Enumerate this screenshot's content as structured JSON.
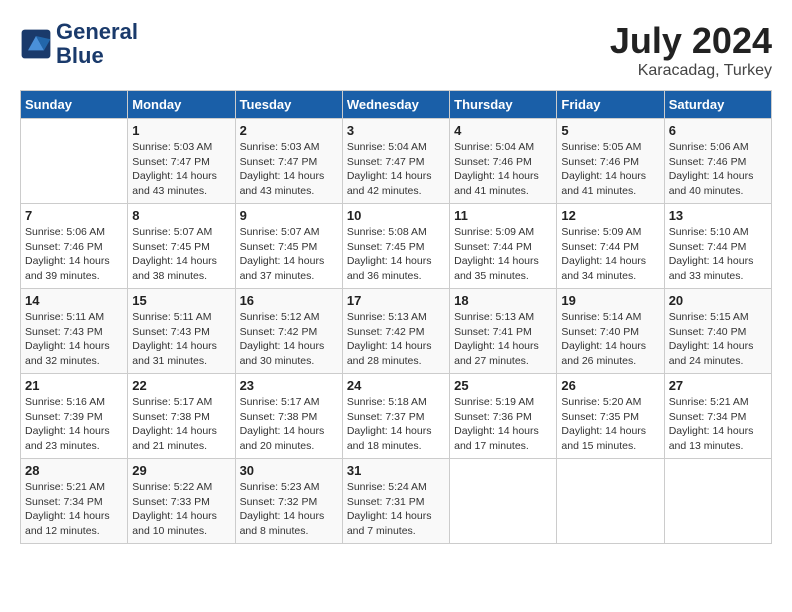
{
  "header": {
    "logo_line1": "General",
    "logo_line2": "Blue",
    "month_year": "July 2024",
    "location": "Karacadag, Turkey"
  },
  "columns": [
    "Sunday",
    "Monday",
    "Tuesday",
    "Wednesday",
    "Thursday",
    "Friday",
    "Saturday"
  ],
  "weeks": [
    [
      {
        "day": "",
        "sunrise": "",
        "sunset": "",
        "daylight": ""
      },
      {
        "day": "1",
        "sunrise": "Sunrise: 5:03 AM",
        "sunset": "Sunset: 7:47 PM",
        "daylight": "Daylight: 14 hours and 43 minutes."
      },
      {
        "day": "2",
        "sunrise": "Sunrise: 5:03 AM",
        "sunset": "Sunset: 7:47 PM",
        "daylight": "Daylight: 14 hours and 43 minutes."
      },
      {
        "day": "3",
        "sunrise": "Sunrise: 5:04 AM",
        "sunset": "Sunset: 7:47 PM",
        "daylight": "Daylight: 14 hours and 42 minutes."
      },
      {
        "day": "4",
        "sunrise": "Sunrise: 5:04 AM",
        "sunset": "Sunset: 7:46 PM",
        "daylight": "Daylight: 14 hours and 41 minutes."
      },
      {
        "day": "5",
        "sunrise": "Sunrise: 5:05 AM",
        "sunset": "Sunset: 7:46 PM",
        "daylight": "Daylight: 14 hours and 41 minutes."
      },
      {
        "day": "6",
        "sunrise": "Sunrise: 5:06 AM",
        "sunset": "Sunset: 7:46 PM",
        "daylight": "Daylight: 14 hours and 40 minutes."
      }
    ],
    [
      {
        "day": "7",
        "sunrise": "Sunrise: 5:06 AM",
        "sunset": "Sunset: 7:46 PM",
        "daylight": "Daylight: 14 hours and 39 minutes."
      },
      {
        "day": "8",
        "sunrise": "Sunrise: 5:07 AM",
        "sunset": "Sunset: 7:45 PM",
        "daylight": "Daylight: 14 hours and 38 minutes."
      },
      {
        "day": "9",
        "sunrise": "Sunrise: 5:07 AM",
        "sunset": "Sunset: 7:45 PM",
        "daylight": "Daylight: 14 hours and 37 minutes."
      },
      {
        "day": "10",
        "sunrise": "Sunrise: 5:08 AM",
        "sunset": "Sunset: 7:45 PM",
        "daylight": "Daylight: 14 hours and 36 minutes."
      },
      {
        "day": "11",
        "sunrise": "Sunrise: 5:09 AM",
        "sunset": "Sunset: 7:44 PM",
        "daylight": "Daylight: 14 hours and 35 minutes."
      },
      {
        "day": "12",
        "sunrise": "Sunrise: 5:09 AM",
        "sunset": "Sunset: 7:44 PM",
        "daylight": "Daylight: 14 hours and 34 minutes."
      },
      {
        "day": "13",
        "sunrise": "Sunrise: 5:10 AM",
        "sunset": "Sunset: 7:44 PM",
        "daylight": "Daylight: 14 hours and 33 minutes."
      }
    ],
    [
      {
        "day": "14",
        "sunrise": "Sunrise: 5:11 AM",
        "sunset": "Sunset: 7:43 PM",
        "daylight": "Daylight: 14 hours and 32 minutes."
      },
      {
        "day": "15",
        "sunrise": "Sunrise: 5:11 AM",
        "sunset": "Sunset: 7:43 PM",
        "daylight": "Daylight: 14 hours and 31 minutes."
      },
      {
        "day": "16",
        "sunrise": "Sunrise: 5:12 AM",
        "sunset": "Sunset: 7:42 PM",
        "daylight": "Daylight: 14 hours and 30 minutes."
      },
      {
        "day": "17",
        "sunrise": "Sunrise: 5:13 AM",
        "sunset": "Sunset: 7:42 PM",
        "daylight": "Daylight: 14 hours and 28 minutes."
      },
      {
        "day": "18",
        "sunrise": "Sunrise: 5:13 AM",
        "sunset": "Sunset: 7:41 PM",
        "daylight": "Daylight: 14 hours and 27 minutes."
      },
      {
        "day": "19",
        "sunrise": "Sunrise: 5:14 AM",
        "sunset": "Sunset: 7:40 PM",
        "daylight": "Daylight: 14 hours and 26 minutes."
      },
      {
        "day": "20",
        "sunrise": "Sunrise: 5:15 AM",
        "sunset": "Sunset: 7:40 PM",
        "daylight": "Daylight: 14 hours and 24 minutes."
      }
    ],
    [
      {
        "day": "21",
        "sunrise": "Sunrise: 5:16 AM",
        "sunset": "Sunset: 7:39 PM",
        "daylight": "Daylight: 14 hours and 23 minutes."
      },
      {
        "day": "22",
        "sunrise": "Sunrise: 5:17 AM",
        "sunset": "Sunset: 7:38 PM",
        "daylight": "Daylight: 14 hours and 21 minutes."
      },
      {
        "day": "23",
        "sunrise": "Sunrise: 5:17 AM",
        "sunset": "Sunset: 7:38 PM",
        "daylight": "Daylight: 14 hours and 20 minutes."
      },
      {
        "day": "24",
        "sunrise": "Sunrise: 5:18 AM",
        "sunset": "Sunset: 7:37 PM",
        "daylight": "Daylight: 14 hours and 18 minutes."
      },
      {
        "day": "25",
        "sunrise": "Sunrise: 5:19 AM",
        "sunset": "Sunset: 7:36 PM",
        "daylight": "Daylight: 14 hours and 17 minutes."
      },
      {
        "day": "26",
        "sunrise": "Sunrise: 5:20 AM",
        "sunset": "Sunset: 7:35 PM",
        "daylight": "Daylight: 14 hours and 15 minutes."
      },
      {
        "day": "27",
        "sunrise": "Sunrise: 5:21 AM",
        "sunset": "Sunset: 7:34 PM",
        "daylight": "Daylight: 14 hours and 13 minutes."
      }
    ],
    [
      {
        "day": "28",
        "sunrise": "Sunrise: 5:21 AM",
        "sunset": "Sunset: 7:34 PM",
        "daylight": "Daylight: 14 hours and 12 minutes."
      },
      {
        "day": "29",
        "sunrise": "Sunrise: 5:22 AM",
        "sunset": "Sunset: 7:33 PM",
        "daylight": "Daylight: 14 hours and 10 minutes."
      },
      {
        "day": "30",
        "sunrise": "Sunrise: 5:23 AM",
        "sunset": "Sunset: 7:32 PM",
        "daylight": "Daylight: 14 hours and 8 minutes."
      },
      {
        "day": "31",
        "sunrise": "Sunrise: 5:24 AM",
        "sunset": "Sunset: 7:31 PM",
        "daylight": "Daylight: 14 hours and 7 minutes."
      },
      {
        "day": "",
        "sunrise": "",
        "sunset": "",
        "daylight": ""
      },
      {
        "day": "",
        "sunrise": "",
        "sunset": "",
        "daylight": ""
      },
      {
        "day": "",
        "sunrise": "",
        "sunset": "",
        "daylight": ""
      }
    ]
  ]
}
